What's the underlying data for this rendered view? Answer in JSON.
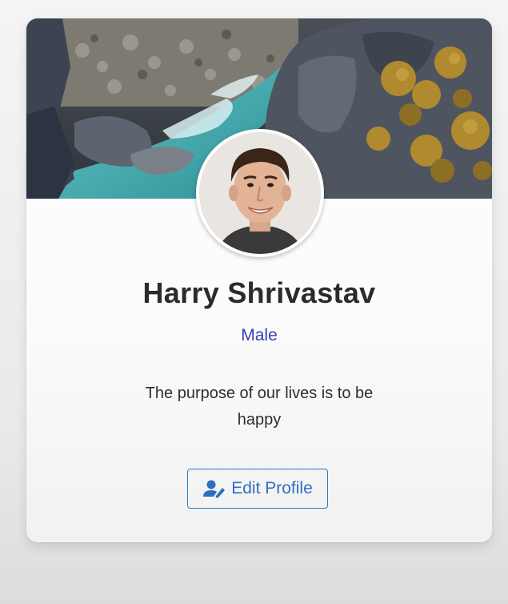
{
  "profile": {
    "name": "Harry Shrivastav",
    "gender": "Male",
    "bio": "The purpose of our lives is to be happy",
    "edit_button_label": "Edit Profile",
    "edit_button_icon": "user-edit-icon",
    "cover_image": "river-rocks-cover-photo",
    "avatar_image": "smiling-man-portrait"
  },
  "colors": {
    "name_text": "#2b2b2b",
    "gender_text": "#3b3bb5",
    "button_border": "#2f78c4",
    "button_text": "#2f6fc0"
  }
}
